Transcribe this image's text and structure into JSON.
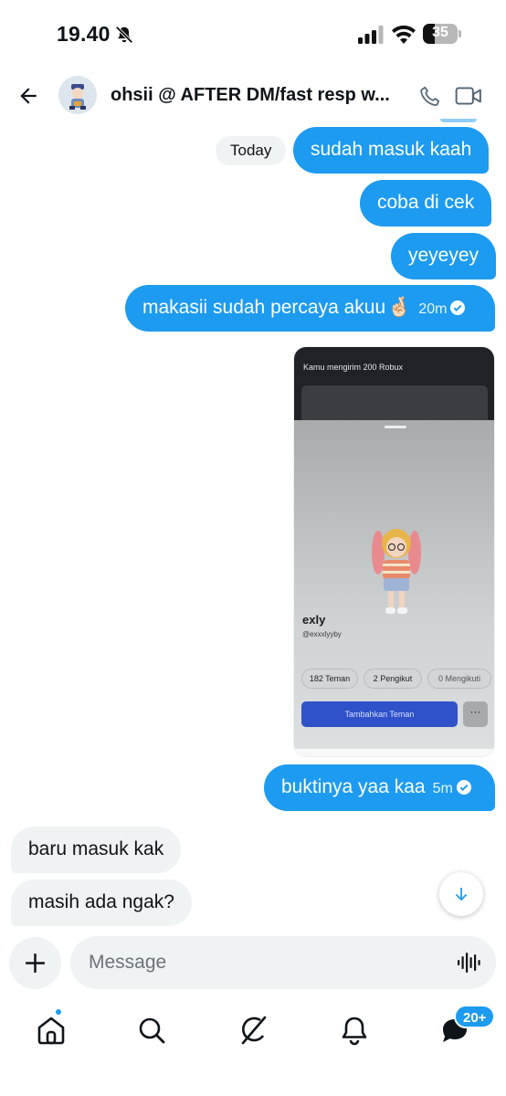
{
  "status_bar": {
    "time": "19.40",
    "battery_level": "35",
    "icons": [
      "bell-off-icon",
      "signal-icon",
      "wifi-icon",
      "battery-icon"
    ]
  },
  "header": {
    "title": "ohsii @ AFTER DM/fast resp w...",
    "icons": [
      "back-arrow-icon",
      "avatar",
      "phone-icon",
      "video-icon"
    ]
  },
  "conversation": {
    "day_label": "Today",
    "messages": [
      {
        "direction": "sent",
        "text": "sudah masuk kaah",
        "time": ""
      },
      {
        "direction": "sent",
        "text": "coba di cek",
        "time": ""
      },
      {
        "direction": "sent",
        "text": "yeyeyey",
        "time": ""
      },
      {
        "direction": "sent",
        "text": "makasii sudah percaya akuu",
        "emoji": "🤞🏻",
        "time": "20m",
        "read": true
      },
      {
        "direction": "sent",
        "type": "image",
        "time": ""
      },
      {
        "direction": "sent",
        "text": "buktinya yaa kaa",
        "time": "5m",
        "read": true
      },
      {
        "direction": "received",
        "text": "baru masuk kak"
      },
      {
        "direction": "received",
        "text": "masih ada ngak?"
      }
    ],
    "attachment": {
      "notification": "Kamu mengirim 200 Robux",
      "display_name": "exly",
      "username": "@exxxlyyby",
      "stats": [
        "182 Teman",
        "2 Pengikut",
        "0 Mengikuti"
      ],
      "primary_button": "Tambahkan Teman",
      "more_button": "···"
    }
  },
  "composer": {
    "placeholder": "Message",
    "value": ""
  },
  "bottom_nav": {
    "items": [
      "home-icon",
      "search-icon",
      "grok-icon",
      "notifications-icon",
      "messages-icon"
    ],
    "messages_badge": "20+"
  },
  "colors": {
    "accent": "#1d9bf0",
    "received_bubble": "#eff3f4",
    "text": "#0f1419"
  }
}
